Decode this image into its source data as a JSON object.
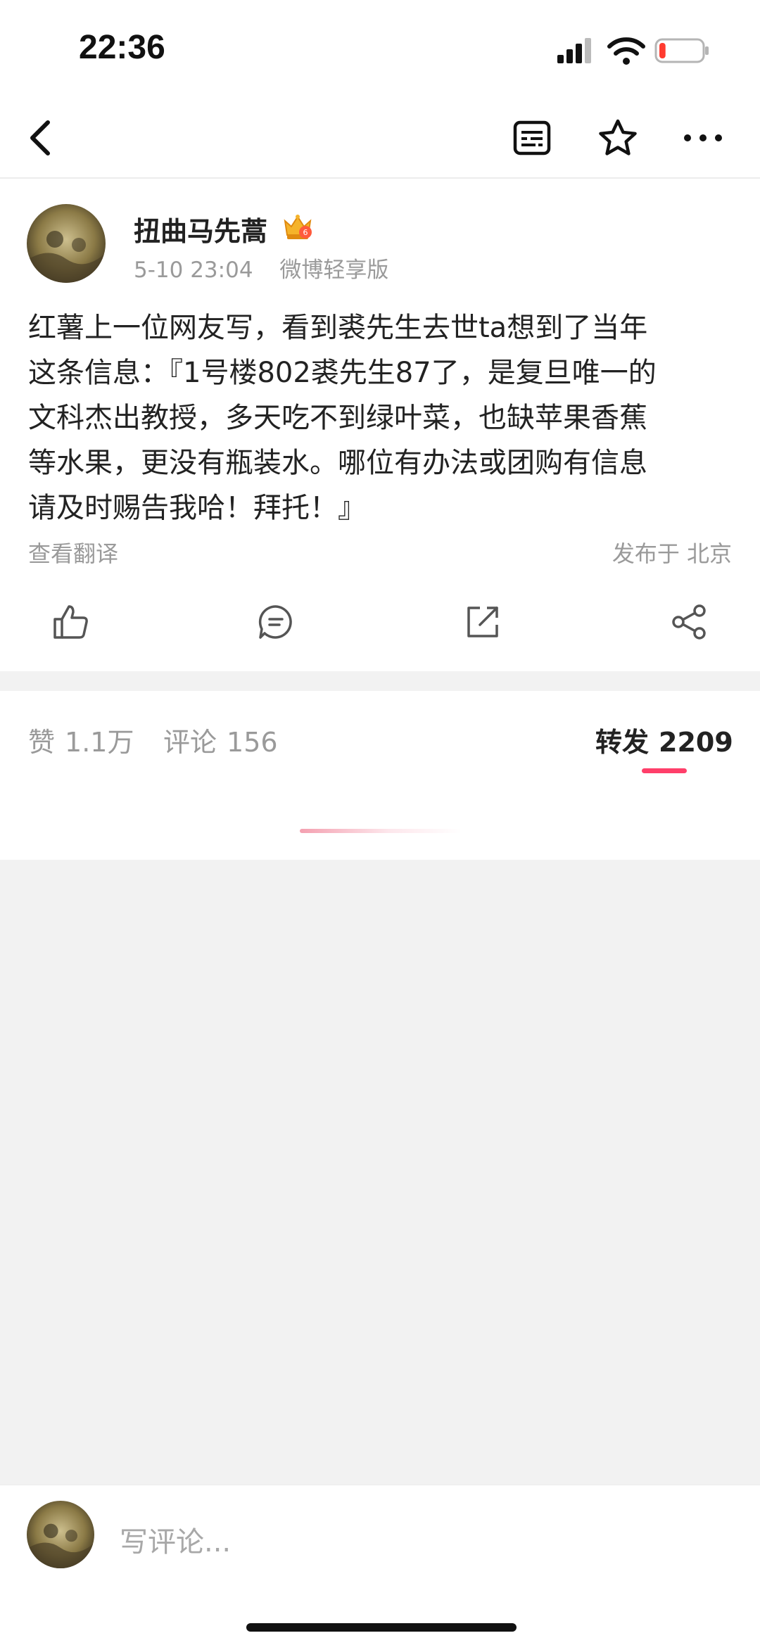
{
  "status_bar": {
    "time": "22:36",
    "battery_level": 0.15
  },
  "nav": {
    "back_icon": "back-arrow-icon",
    "icons": [
      "reader-mode-icon",
      "star-icon",
      "more-icon"
    ]
  },
  "post": {
    "author": {
      "name": "扭曲马先蒿",
      "badge": "vip-crown-icon"
    },
    "time": "5-10 23:04",
    "source": "微博轻享版",
    "content_lines": [
      "红薯上一位网友写，看到裘先生去世ta想到了当年",
      "这条信息：『1号楼802裘先生87了，是复旦唯一的",
      "文科杰出教授，多天吃不到绿叶菜，也缺苹果香蕉",
      "等水果，更没有瓶装水。哪位有办法或团购有信息",
      "请及时赐告我哈！拜托！』"
    ],
    "translate_label": "查看翻译",
    "location": "发布于 北京",
    "actions": [
      "like-icon",
      "comment-icon",
      "repost-icon",
      "share-icon"
    ]
  },
  "tabs": [
    {
      "label": "赞",
      "count": "1.1万"
    },
    {
      "label": "评论",
      "count": "156"
    },
    {
      "label": "转发",
      "count": "2209",
      "active": true
    }
  ],
  "colors": {
    "accent": "#ff3f6a",
    "battery_low": "#ff3b30",
    "muted_text": "#9a9a9a"
  },
  "comment_bar": {
    "placeholder": "写评论..."
  }
}
